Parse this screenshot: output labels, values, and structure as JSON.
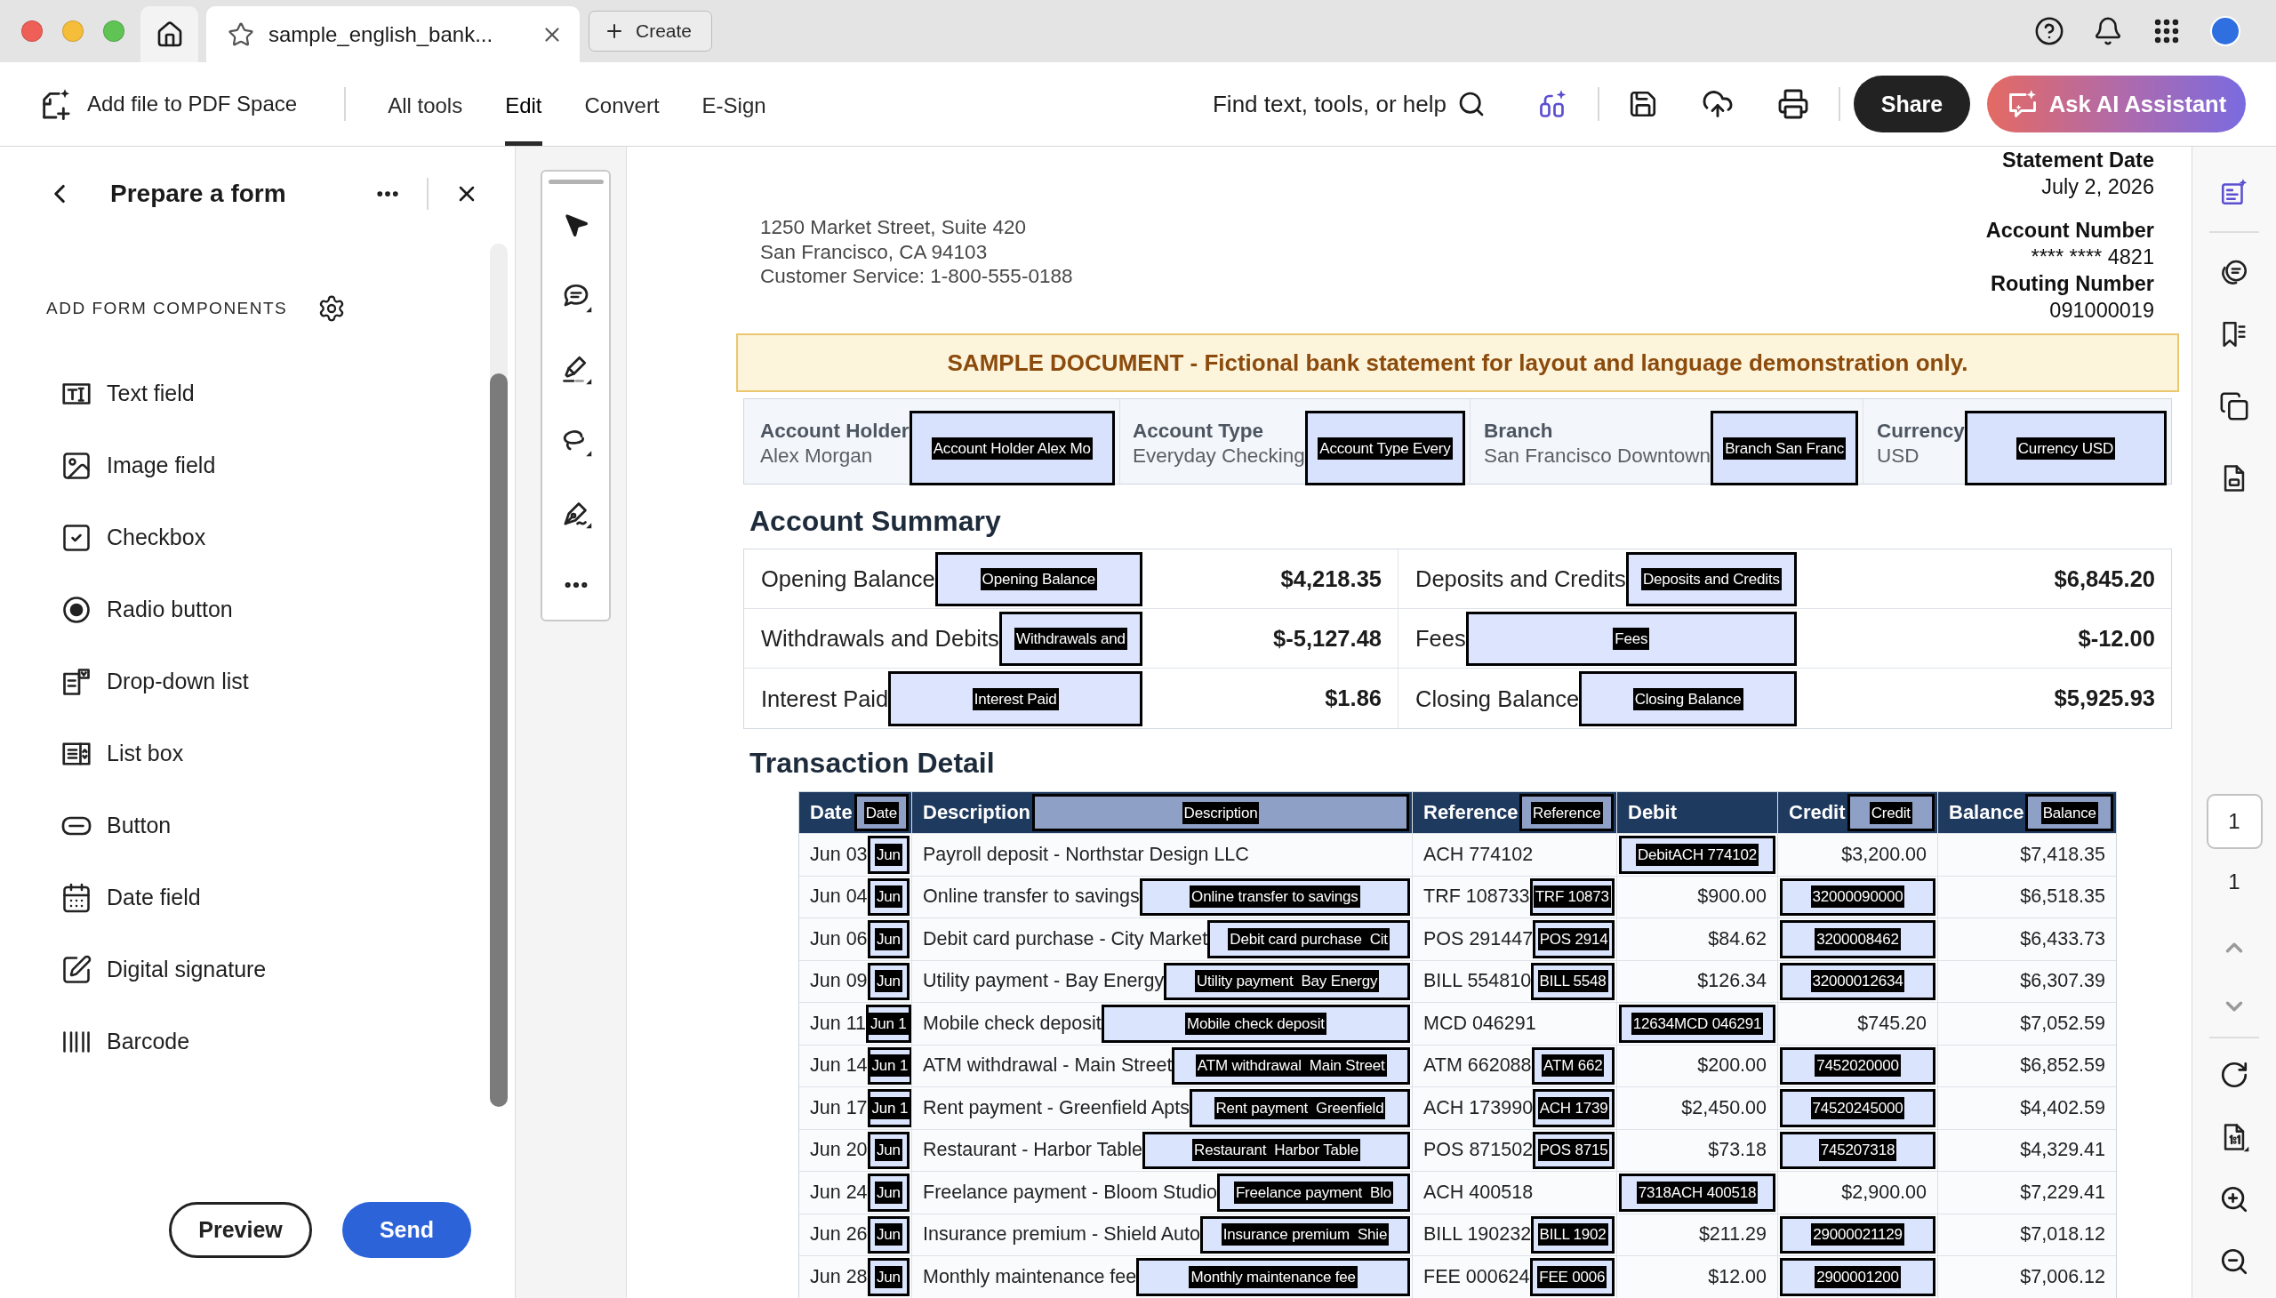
{
  "browser": {
    "tab": {
      "title": "sample_english_bank...",
      "selected": true
    },
    "create_button": "Create"
  },
  "toolbar": {
    "add_file": "Add file to PDF Space",
    "menu": [
      {
        "label": "All tools",
        "selected": false
      },
      {
        "label": "Edit",
        "selected": true
      },
      {
        "label": "Convert",
        "selected": false
      },
      {
        "label": "E-Sign",
        "selected": false
      }
    ],
    "search_label": "Find text, tools, or help",
    "share_button": "Share",
    "assistant_button": "Ask AI Assistant"
  },
  "form_panel": {
    "title": "Prepare a form",
    "section_title": "ADD FORM COMPONENTS",
    "components": [
      {
        "kind": "text",
        "label": "Text field"
      },
      {
        "kind": "image",
        "label": "Image field"
      },
      {
        "kind": "checkbox",
        "label": "Checkbox"
      },
      {
        "kind": "radio",
        "label": "Radio button"
      },
      {
        "kind": "dropdown",
        "label": "Drop-down list"
      },
      {
        "kind": "listbox",
        "label": "List box"
      },
      {
        "kind": "button",
        "label": "Button"
      },
      {
        "kind": "date",
        "label": "Date field"
      },
      {
        "kind": "signature",
        "label": "Digital signature"
      },
      {
        "kind": "barcode",
        "label": "Barcode"
      }
    ],
    "preview_button": "Preview",
    "send_button": "Send"
  },
  "document": {
    "address_lines": [
      "1250 Market Street, Suite 420",
      "San Francisco, CA 94103",
      "Customer Service: 1-800-555-0188"
    ],
    "statement_info": [
      {
        "label": "Statement Date",
        "value": "July 2, 2026"
      },
      {
        "label": "Account Number",
        "value": "**** **** 4821"
      },
      {
        "label": "Routing Number",
        "value": "091000019"
      }
    ],
    "notice": "SAMPLE DOCUMENT - Fictional bank statement for layout and language demonstration only.",
    "account_details": [
      {
        "label": "Account Holder",
        "value": "Alex Morgan",
        "form_field": "Account Holder Alex Mo"
      },
      {
        "label": "Account Type",
        "value": "Everyday Checking",
        "form_field": "Account Type Every"
      },
      {
        "label": "Branch",
        "value": "San Francisco Downtown",
        "form_field": "Branch San Franc"
      },
      {
        "label": "Currency",
        "value": "USD",
        "form_field": "Currency USD"
      }
    ],
    "account_summary": {
      "title": "Account Summary",
      "items": [
        {
          "label": "Opening Balance",
          "form_field": "Opening Balance",
          "amount": "$4,218.35"
        },
        {
          "label": "Deposits and Credits",
          "form_field": "Deposits and Credits",
          "amount": "$6,845.20"
        },
        {
          "label": "Withdrawals and Debits",
          "form_field": "Withdrawals and",
          "amount": "$-5,127.48"
        },
        {
          "label": "Fees",
          "form_field": "Fees",
          "amount": "$-12.00"
        },
        {
          "label": "Interest Paid",
          "form_field": "Interest Paid",
          "amount": "$1.86"
        },
        {
          "label": "Closing Balance",
          "form_field": "Closing Balance",
          "amount": "$5,925.93"
        }
      ]
    },
    "transaction_detail": {
      "title": "Transaction Detail",
      "columns": [
        {
          "label": "Date",
          "kind": "date",
          "form_field": "Date"
        },
        {
          "label": "Description",
          "kind": "text",
          "form_field": "Description"
        },
        {
          "label": "Reference",
          "kind": "text",
          "form_field": "Reference"
        },
        {
          "label": "Debit",
          "kind": "amount"
        },
        {
          "label": "Credit",
          "kind": "amount",
          "form_field": "Credit"
        },
        {
          "label": "Balance",
          "kind": "amount",
          "form_field": "Balance"
        }
      ],
      "rows": [
        {
          "cells": [
            {
              "text": "Jun 03",
              "form_field": "Jun"
            },
            {
              "text": "Payroll deposit - Northstar Design LLC"
            },
            {
              "text": "ACH 774102"
            },
            {
              "form_field": "DebitACH 774102"
            },
            {
              "text": "$3,200.00"
            },
            {
              "text": "$7,418.35"
            }
          ]
        },
        {
          "cells": [
            {
              "text": "Jun 04",
              "form_field": "Jun"
            },
            {
              "text": "Online transfer to savings",
              "form_field": "Online transfer to savings"
            },
            {
              "text": "TRF 108733",
              "form_field": "TRF 10873"
            },
            {
              "text": "$900.00"
            },
            {
              "form_field": "32000090000"
            },
            {
              "text": "$6,518.35"
            }
          ]
        },
        {
          "cells": [
            {
              "text": "Jun 06",
              "form_field": "Jun"
            },
            {
              "text": "Debit card purchase - City Market",
              "form_field": "Debit card purchase  Cit"
            },
            {
              "text": "POS 291447",
              "form_field": "POS 2914"
            },
            {
              "text": "$84.62"
            },
            {
              "form_field": "3200008462"
            },
            {
              "text": "$6,433.73"
            }
          ]
        },
        {
          "cells": [
            {
              "text": "Jun 09",
              "form_field": "Jun"
            },
            {
              "text": "Utility payment - Bay Energy",
              "form_field": "Utility payment  Bay Energy"
            },
            {
              "text": "BILL 554810",
              "form_field": "BILL 5548"
            },
            {
              "text": "$126.34"
            },
            {
              "form_field": "32000012634"
            },
            {
              "text": "$6,307.39"
            }
          ]
        },
        {
          "cells": [
            {
              "text": "Jun 11",
              "form_field": "Jun 1"
            },
            {
              "text": "Mobile check deposit",
              "form_field": "Mobile check deposit"
            },
            {
              "text": "MCD 046291"
            },
            {
              "form_field": "12634MCD 046291"
            },
            {
              "text": "$745.20"
            },
            {
              "text": "$7,052.59"
            }
          ]
        },
        {
          "cells": [
            {
              "text": "Jun 14",
              "form_field": "Jun 1"
            },
            {
              "text": "ATM withdrawal - Main Street",
              "form_field": "ATM withdrawal  Main Street"
            },
            {
              "text": "ATM 662088",
              "form_field": "ATM 662"
            },
            {
              "text": "$200.00"
            },
            {
              "form_field": "7452020000"
            },
            {
              "text": "$6,852.59"
            }
          ]
        },
        {
          "cells": [
            {
              "text": "Jun 17",
              "form_field": "Jun 1"
            },
            {
              "text": "Rent payment - Greenfield Apts",
              "form_field": "Rent payment  Greenfield"
            },
            {
              "text": "ACH 173990",
              "form_field": "ACH 1739"
            },
            {
              "text": "$2,450.00"
            },
            {
              "form_field": "74520245000"
            },
            {
              "text": "$4,402.59"
            }
          ]
        },
        {
          "cells": [
            {
              "text": "Jun 20",
              "form_field": "Jun"
            },
            {
              "text": "Restaurant - Harbor Table",
              "form_field": "Restaurant  Harbor Table"
            },
            {
              "text": "POS 871502",
              "form_field": "POS 8715"
            },
            {
              "text": "$73.18"
            },
            {
              "form_field": "745207318"
            },
            {
              "text": "$4,329.41"
            }
          ]
        },
        {
          "cells": [
            {
              "text": "Jun 24",
              "form_field": "Jun"
            },
            {
              "text": "Freelance payment - Bloom Studio",
              "form_field": "Freelance payment  Blo"
            },
            {
              "text": "ACH 400518"
            },
            {
              "form_field": "7318ACH 400518"
            },
            {
              "text": "$2,900.00"
            },
            {
              "text": "$7,229.41"
            }
          ]
        },
        {
          "cells": [
            {
              "text": "Jun 26",
              "form_field": "Jun"
            },
            {
              "text": "Insurance premium - Shield Auto",
              "form_field": "Insurance premium  Shie"
            },
            {
              "text": "BILL 190232",
              "form_field": "BILL 1902"
            },
            {
              "text": "$211.29"
            },
            {
              "form_field": "29000021129"
            },
            {
              "text": "$7,018.12"
            }
          ]
        },
        {
          "cells": [
            {
              "text": "Jun 28",
              "form_field": "Jun"
            },
            {
              "text": "Monthly maintenance fee",
              "form_field": "Monthly maintenance fee"
            },
            {
              "text": "FEE 000624",
              "form_field": "FEE 0006"
            },
            {
              "text": "$12.00"
            },
            {
              "form_field": "2900001200"
            },
            {
              "text": "$7,006.12"
            }
          ]
        }
      ]
    }
  },
  "page_navigator": {
    "current_page": "1",
    "page_count": "1"
  }
}
